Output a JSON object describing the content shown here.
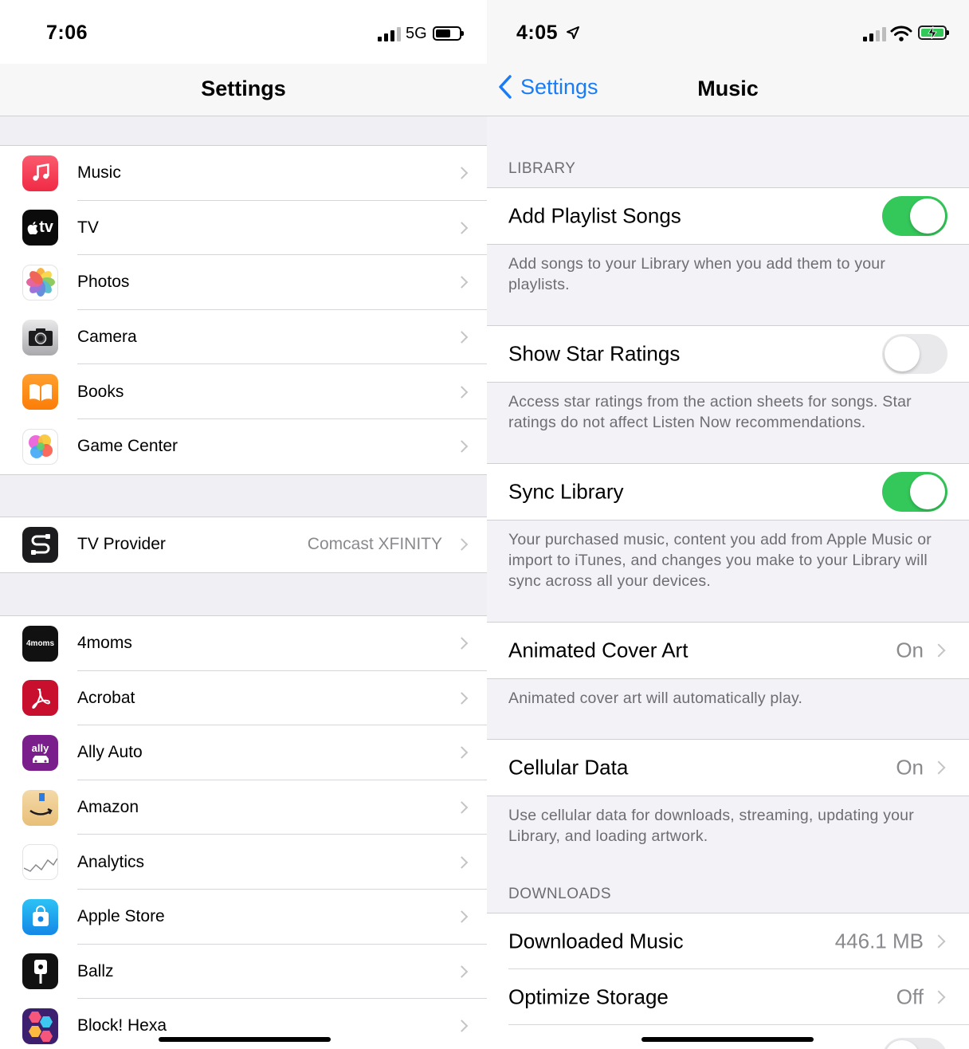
{
  "left": {
    "status": {
      "time": "7:06",
      "network": "5G"
    },
    "nav_title": "Settings",
    "groups": [
      [
        {
          "label": "Music",
          "icon": "music-icon"
        },
        {
          "label": "TV",
          "icon": "apple-tv-icon"
        },
        {
          "label": "Photos",
          "icon": "photos-icon"
        },
        {
          "label": "Camera",
          "icon": "camera-icon"
        },
        {
          "label": "Books",
          "icon": "books-icon"
        },
        {
          "label": "Game Center",
          "icon": "game-center-icon"
        }
      ],
      [
        {
          "label": "TV Provider",
          "value": "Comcast XFINITY",
          "icon": "tv-provider-icon"
        }
      ],
      [
        {
          "label": "4moms",
          "icon": "4moms-icon"
        },
        {
          "label": "Acrobat",
          "icon": "acrobat-icon"
        },
        {
          "label": "Ally Auto",
          "icon": "ally-auto-icon"
        },
        {
          "label": "Amazon",
          "icon": "amazon-icon"
        },
        {
          "label": "Analytics",
          "icon": "analytics-icon"
        },
        {
          "label": "Apple Store",
          "icon": "apple-store-icon"
        },
        {
          "label": "Ballz",
          "icon": "ballz-icon"
        },
        {
          "label": "Block! Hexa",
          "icon": "block-hexa-icon"
        }
      ]
    ],
    "icon_text": {
      "tv": "tv",
      "moms": "4moms",
      "ally": "ally"
    }
  },
  "right": {
    "status": {
      "time": "4:05"
    },
    "back_label": "Settings",
    "nav_title": "Music",
    "library_header": "LIBRARY",
    "add_playlist_songs": {
      "label": "Add Playlist Songs",
      "on": true,
      "footer": "Add songs to your Library when you add them to your playlists."
    },
    "show_star_ratings": {
      "label": "Show Star Ratings",
      "on": false,
      "footer": "Access star ratings from the action sheets for songs. Star ratings do not affect Listen Now recommendations."
    },
    "sync_library": {
      "label": "Sync Library",
      "on": true,
      "footer": "Your purchased music, content you add from Apple Music or import to iTunes, and changes you make to your Library will sync across all your devices."
    },
    "animated_cover_art": {
      "label": "Animated Cover Art",
      "value": "On",
      "footer": "Animated cover art will automatically play."
    },
    "cellular_data": {
      "label": "Cellular Data",
      "value": "On",
      "footer": "Use cellular data for downloads, streaming, updating your Library, and loading artwork."
    },
    "downloads_header": "DOWNLOADS",
    "downloaded_music": {
      "label": "Downloaded Music",
      "value": "446.1 MB"
    },
    "optimize_storage": {
      "label": "Optimize Storage",
      "value": "Off"
    }
  },
  "colors": {
    "accent": "#1a7cf5",
    "toggle_on": "#34c759"
  }
}
